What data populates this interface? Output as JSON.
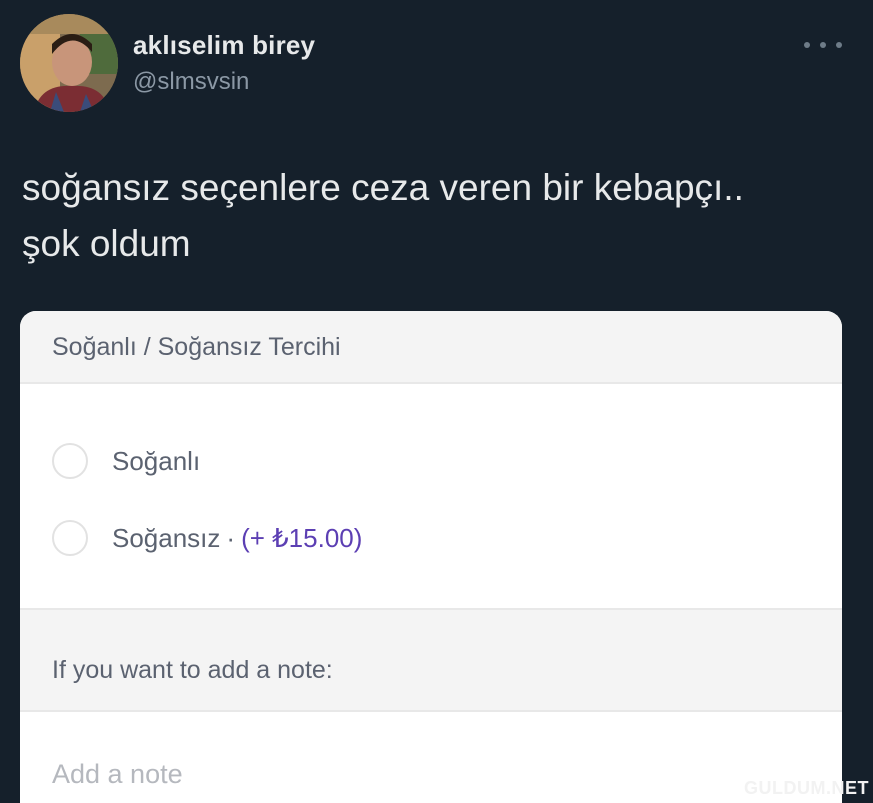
{
  "tweet": {
    "display_name": "aklıselim birey",
    "handle": "@slmsvsin",
    "text_lines": [
      "soğansız seçenlere ceza veren bir kebapçı..",
      "şok oldum"
    ]
  },
  "card": {
    "header_title": "Soğanlı / Soğansız Tercihi",
    "options": [
      {
        "label": "Soğanlı",
        "price": ""
      },
      {
        "label": "Soğansız",
        "separator": "·",
        "price": "(+ ₺15.00)"
      }
    ],
    "note_label": "If you want to add a note:",
    "note_placeholder": "Add a note"
  },
  "watermark": "GULDUM.NET",
  "colors": {
    "background": "#15202b",
    "price_accent": "#5c3fb3"
  }
}
